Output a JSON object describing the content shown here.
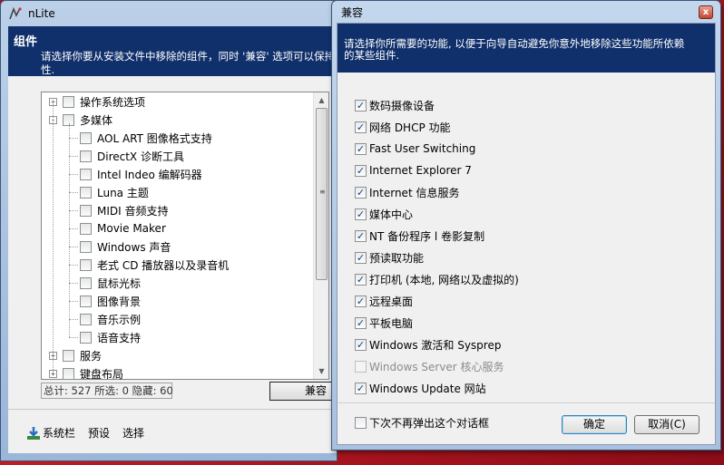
{
  "main": {
    "title": "nLite",
    "header_title": "组件",
    "header_desc_line1": "请选择你要从安装文件中移除的组件，同时 '兼容' 选项可以保持",
    "header_desc_line2": "性.",
    "tree": [
      {
        "label": "操作系统选项",
        "expander": "+",
        "indent": 0
      },
      {
        "label": "多媒体",
        "expander": "-",
        "indent": 0
      },
      {
        "label": "AOL ART 图像格式支持",
        "indent": 1
      },
      {
        "label": "DirectX 诊断工具",
        "indent": 1
      },
      {
        "label": "Intel Indeo 编解码器",
        "indent": 1
      },
      {
        "label": "Luna 主题",
        "indent": 1
      },
      {
        "label": "MIDI 音频支持",
        "indent": 1
      },
      {
        "label": "Movie Maker",
        "indent": 1
      },
      {
        "label": "Windows 声音",
        "indent": 1
      },
      {
        "label": "老式 CD 播放器以及录音机",
        "indent": 1
      },
      {
        "label": "鼠标光标",
        "indent": 1
      },
      {
        "label": "图像背景",
        "indent": 1
      },
      {
        "label": "音乐示例",
        "indent": 1
      },
      {
        "label": "语音支持",
        "indent": 1
      },
      {
        "label": "服务",
        "expander": "+",
        "indent": 0
      },
      {
        "label": "键盘布局",
        "expander": "+",
        "indent": 0
      }
    ],
    "status": "总计: 527 所选: 0 隐藏: 60",
    "compat_button": "兼容",
    "bottom": {
      "sysbar": "系统栏",
      "preset": "预设",
      "select": "选择"
    }
  },
  "dialog": {
    "title": "兼容",
    "close_glyph": "x",
    "header_line1": "请选择你所需要的功能, 以便于向导自动避免你意外地移除这些功能所依赖",
    "header_line2": "的某些组件.",
    "options": [
      {
        "label": "数码摄像设备",
        "checked": true
      },
      {
        "label": "网络 DHCP 功能",
        "checked": true
      },
      {
        "label": "Fast User Switching",
        "checked": true
      },
      {
        "label": "Internet Explorer 7",
        "checked": true
      },
      {
        "label": "Internet 信息服务",
        "checked": true
      },
      {
        "label": "媒体中心",
        "checked": true
      },
      {
        "label": "NT 备份程序 l 卷影复制",
        "checked": true
      },
      {
        "label": "预读取功能",
        "checked": true
      },
      {
        "label": "打印机 (本地, 网络以及虚拟的)",
        "checked": true
      },
      {
        "label": "远程桌面",
        "checked": true
      },
      {
        "label": "平板电脑",
        "checked": true
      },
      {
        "label": "Windows 激活和 Sysprep",
        "checked": true
      },
      {
        "label": "Windows Server 核心服务",
        "checked": false,
        "disabled": true
      },
      {
        "label": "Windows Update 网站",
        "checked": true
      }
    ],
    "dont_show_label": "下次不再弹出这个对话框",
    "dont_show_checked": false,
    "ok_label": "确定",
    "cancel_label": "取消(C)"
  },
  "colors": {
    "header_band": "#10306b",
    "check_color": "#1c3f7a"
  }
}
